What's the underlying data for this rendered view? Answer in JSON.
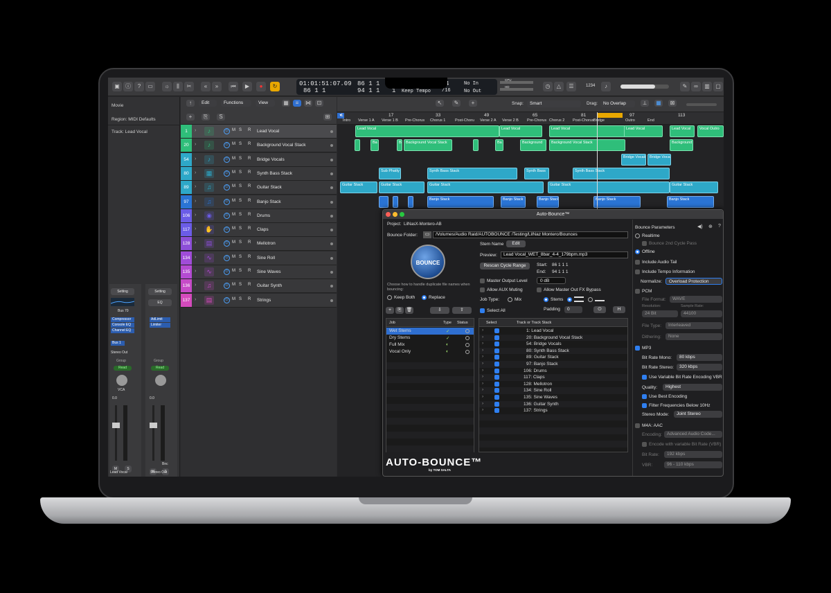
{
  "lcd": {
    "position": "01:01:51:07.09",
    "bars_top": "86  1  1",
    "bars_top2": "1",
    "bars_bottom": "86  1  1",
    "bars_bottom2": "94  1  1",
    "bars_bottom3": "1",
    "sig": "4",
    "div": "/16",
    "keep_tempo": "Keep Tempo",
    "no_in": "No In",
    "no_out": "No Out",
    "cpu": "CPU",
    "hd": "HD"
  },
  "toolbar_right": {
    "zoom": "1234"
  },
  "inspector": {
    "movie": "Movie",
    "region": "Region: MIDI Defaults",
    "track": "Track: Lead Vocal"
  },
  "strips": [
    {
      "setting": "Setting",
      "eq": "",
      "bus": "Bus 70",
      "plugins": [
        "Compressor",
        "Console EQ",
        "Channel EQ"
      ],
      "bus_out": "Bus 1",
      "out": "Stereo Out",
      "group": "Group",
      "read": "Read",
      "vca": "VCA",
      "val": "0.0",
      "mute": "M",
      "solo": "S",
      "name": "Lead Vocal"
    },
    {
      "setting": "Setting",
      "eq": "EQ",
      "bus": "",
      "plugins": [
        "AdLimit",
        "Limiter"
      ],
      "bus_out": "",
      "out": "",
      "group": "Group",
      "read": "Read",
      "vca": "",
      "val": "0.0",
      "mute": "M",
      "solo": "S",
      "bnc": "Bnc",
      "name": "Stereo Out"
    }
  ],
  "tracks_hdr": {
    "edit": "Edit",
    "functions": "Functions",
    "view": "View",
    "add": "+",
    "s": "S"
  },
  "tracks": [
    {
      "num": "1",
      "color": "#2fbe7a",
      "name": "Lead Vocal",
      "icon": "♪"
    },
    {
      "num": "20",
      "color": "#2fbe7a",
      "name": "Background Vocal Stack",
      "icon": "♪"
    },
    {
      "num": "54",
      "color": "#2ea8c8",
      "name": "Bridge Vocals",
      "icon": "♪"
    },
    {
      "num": "80",
      "color": "#2ea8c8",
      "name": "Synth Bass Stack",
      "icon": "▦"
    },
    {
      "num": "89",
      "color": "#2ea8c8",
      "name": "Guitar Stack",
      "icon": "♫"
    },
    {
      "num": "97",
      "color": "#2a74d4",
      "name": "Banjo Stack",
      "icon": "♫"
    },
    {
      "num": "106",
      "color": "#6b5ce7",
      "name": "Drums",
      "icon": "◉"
    },
    {
      "num": "117",
      "color": "#6b5ce7",
      "name": "Claps",
      "icon": "✋"
    },
    {
      "num": "128",
      "color": "#8d4fd8",
      "name": "Mellotron",
      "icon": "▤"
    },
    {
      "num": "134",
      "color": "#a04cd8",
      "name": "Sine Roll",
      "icon": "∿"
    },
    {
      "num": "135",
      "color": "#b44bd2",
      "name": "Sine Waves",
      "icon": "∿"
    },
    {
      "num": "136",
      "color": "#c64bc8",
      "name": "Guitar Synth",
      "icon": "♫"
    },
    {
      "num": "137",
      "color": "#d44bbd",
      "name": "Strings",
      "icon": "▤"
    }
  ],
  "arrange_hdr": {
    "snap_label": "Snap:",
    "snap": "Smart",
    "drag_label": "Drag:",
    "drag": "No Overlap"
  },
  "ruler": [
    "1",
    "17",
    "33",
    "49",
    "65",
    "81",
    "97",
    "113"
  ],
  "markers": [
    "Intro",
    "Verse 1 A",
    "Verse 1 B",
    "Pre-Chorus",
    "Chorus 1",
    "Post-Choru",
    "Verse 2 A",
    "Verse 2 B",
    "Pre-Chorus",
    "Chorus 2",
    "Post-Chorus",
    "Bridge",
    "Outro",
    "End"
  ],
  "plugin": {
    "title": "Auto-Bounce™",
    "project_label": "Project:",
    "project": "LilNasX-Montero-AB",
    "folder_label": "Bounce Folder:",
    "folder": "/Volumes/Audio Raid/AUTOBOUNCE /Testing/LilNaz Montero/Bounces",
    "bounce": "BOUNCE",
    "stem_name": "Stem Name",
    "edit": "Edit",
    "preview_label": "Preview:",
    "preview": "Lead Vocal_WET_8bar_4-4_179bpm.mp3",
    "rescan": "Rescan Cycle Range",
    "start_label": "Start:",
    "start": "86     1     1     1",
    "end_label": "End:",
    "end": "94     1     1     1",
    "dup_text": "Choose how to handle duplicate file names when bouncing:",
    "keep_both": "Keep Both",
    "replace": "Replace",
    "master_level": "Master Output Level",
    "level": "0 dB",
    "aux": "Allow AUX Muting",
    "fx": "Allow Master Out FX Bypass",
    "job_type": "Job Type:",
    "mix": "Mix",
    "stems": "Stems",
    "select_all": "Select All",
    "padding": "Padding",
    "pad": "0",
    "h": "H",
    "job_cols": [
      "Job",
      "Type",
      "Status"
    ],
    "jobs": [
      "Wet Stems",
      "Dry Stems",
      "Full Mix",
      "Vocal Only"
    ],
    "track_cols": [
      "Select",
      "Track or Track Stack"
    ],
    "tracklist": [
      "1:  Lead Vocal",
      "20:  Background Vocal Stack",
      "54:  Bridge Vocals",
      "80:  Synth Bass Stack",
      "89:  Guitar Stack",
      "97:  Banjo Stack",
      "106:  Drums",
      "117:  Claps",
      "128:  Mellotron",
      "134:  Sine Roll",
      "135:  Sine Waves",
      "136:  Guitar Synth",
      "137:  Strings"
    ],
    "logo": "AUTO-BOUNCE™",
    "logo_by": "by TOM SALTA",
    "params": {
      "title": "Bounce Parameters",
      "realtime": "Realtime",
      "cycle2": "Bounce 2nd Cycle Pass",
      "offline": "Offline",
      "tail": "Include Audio Tail",
      "tempo": "Include Tempo Information",
      "normalize_label": "Normalize:",
      "normalize": "Overload Protection",
      "pcm": "PCM",
      "fmt_label": "File Format:",
      "fmt": "WAVE",
      "res_label": "Resolution:",
      "res": "24 Bit",
      "sr_label": "Sample Rate:",
      "sr": "44100",
      "ftype_label": "File Type:",
      "ftype": "Interleaved",
      "dither_label": "Dithering:",
      "dither": "None",
      "mp3": "MP3",
      "brm_label": "Bit Rate Mono:",
      "brm": "80 kbps",
      "brs_label": "Bit Rate Stereo:",
      "brs": "320 kbps",
      "vbr": "Use Variable Bit Rate Encoding VBR",
      "q_label": "Quality:",
      "q": "Highest",
      "best": "Use Best Encoding",
      "filter": "Filter Frequencies Below 10Hz",
      "sm_label": "Stereo Mode:",
      "sm": "Joint Stereo",
      "m4a": "M4A: AAC",
      "enc_label": "Encoding:",
      "enc": "Advanced Audio Code...",
      "encvbr": "Encode with variable Bit Rate (VBR)",
      "br_label": "Bit Rate:",
      "br": "192 kbps",
      "vbr_label": "VBR:",
      "vbrv": "96 - 110 kbps"
    }
  }
}
